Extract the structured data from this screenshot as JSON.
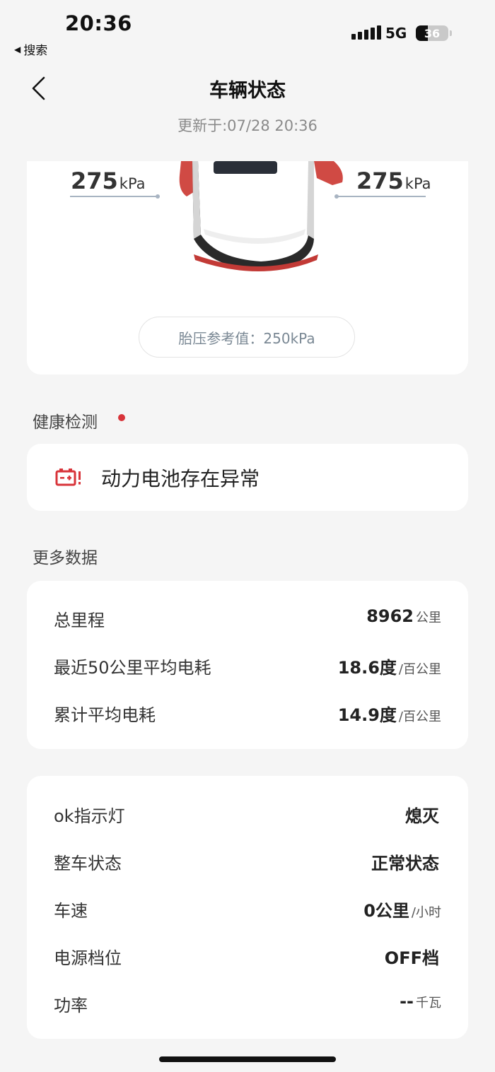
{
  "status_bar": {
    "time": "20:36",
    "back_app_label": "搜索",
    "network": "5G",
    "battery_level": "36",
    "battery_fraction": 0.36
  },
  "header": {
    "title": "车辆状态",
    "updated": "更新于:07/28 20:36"
  },
  "tire": {
    "front_left": "275",
    "front_right": "275",
    "unit": "kPa",
    "reference": "胎压参考值：250kPa",
    "colors": {
      "accent_red": "#d04a44",
      "line": "#a8b4c2"
    }
  },
  "health": {
    "section_title": "健康检测",
    "alert_text": "动力电池存在异常",
    "alert_color": "#d8343a",
    "icon": "battery-warning-icon"
  },
  "more_data": {
    "section_title": "更多数据",
    "rows": [
      {
        "label": "总里程",
        "value": "8962",
        "unit": "公里"
      },
      {
        "label": "最近50公里平均电耗",
        "value": "18.6度",
        "unit": "/百公里"
      },
      {
        "label": "累计平均电耗",
        "value": "14.9度",
        "unit": "/百公里"
      }
    ]
  },
  "status_data": {
    "rows": [
      {
        "label": "ok指示灯",
        "value": "熄灭",
        "unit": ""
      },
      {
        "label": "整车状态",
        "value": "正常状态",
        "unit": ""
      },
      {
        "label": "车速",
        "value": "0公里",
        "unit": "/小时"
      },
      {
        "label": "电源档位",
        "value": "OFF档",
        "unit": ""
      },
      {
        "label": "功率",
        "value": "--",
        "unit": "千瓦"
      }
    ]
  }
}
